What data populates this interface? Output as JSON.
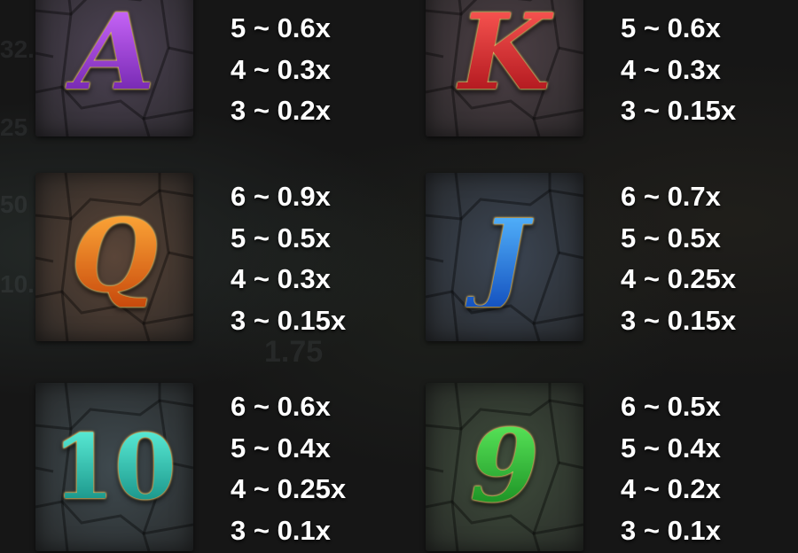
{
  "symbols": [
    {
      "name": "A",
      "color_top": "#d06cff",
      "color_bottom": "#6a1fa8",
      "tile": "#4d4354",
      "pays": [
        "5 ~ 0.6x",
        "4 ~ 0.3x",
        "3 ~ 0.2x"
      ]
    },
    {
      "name": "K",
      "color_top": "#ff5a55",
      "color_bottom": "#a81018",
      "tile": "#4d4046",
      "pays": [
        "5 ~ 0.6x",
        "4 ~ 0.3x",
        "3 ~ 0.15x"
      ]
    },
    {
      "name": "Q",
      "color_top": "#ffab3a",
      "color_bottom": "#c84a0c",
      "tile": "#5a4538",
      "pays": [
        "6 ~ 0.9x",
        "5 ~ 0.5x",
        "4 ~ 0.3x",
        "3 ~ 0.15x"
      ]
    },
    {
      "name": "J",
      "color_top": "#56b8ff",
      "color_bottom": "#1553c0",
      "tile": "#3c4654",
      "pays": [
        "6 ~ 0.7x",
        "5 ~ 0.5x",
        "4 ~ 0.25x",
        "3 ~ 0.15x"
      ]
    },
    {
      "name": "10",
      "color_top": "#5ff3dc",
      "color_bottom": "#128a80",
      "tile": "#3f4a4f",
      "pays": [
        "6 ~ 0.6x",
        "5 ~ 0.4x",
        "4 ~ 0.25x",
        "3 ~ 0.1x"
      ]
    },
    {
      "name": "9",
      "color_top": "#5cea5c",
      "color_bottom": "#14861d",
      "tile": "#3f4d3c",
      "pays": [
        "6 ~ 0.5x",
        "5 ~ 0.4x",
        "4 ~ 0.2x",
        "3 ~ 0.1x"
      ]
    }
  ],
  "background_fragments": [
    "1.75",
    "32.",
    "50",
    "10.",
    "25"
  ]
}
